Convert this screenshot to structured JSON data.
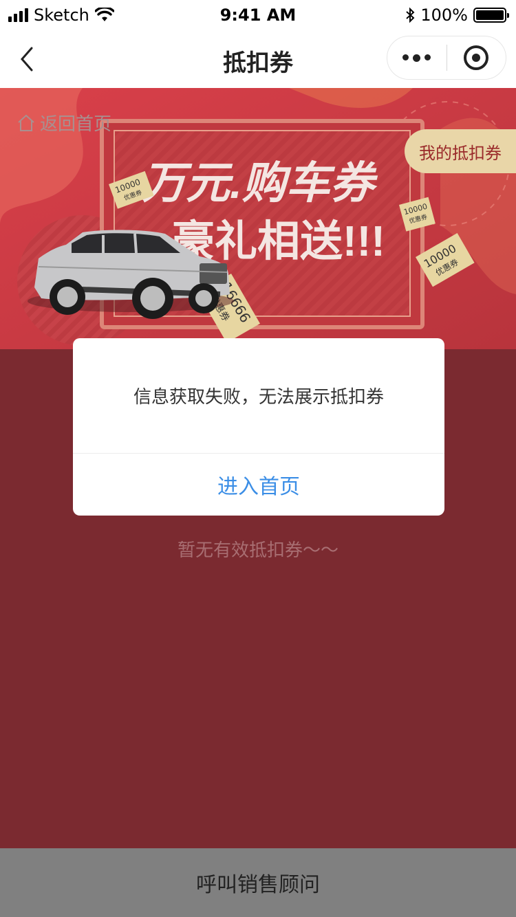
{
  "status_bar": {
    "carrier": "Sketch",
    "time": "9:41 AM",
    "battery": "100%"
  },
  "nav": {
    "title": "抵扣券",
    "icons": [
      "back-chevron-icon",
      "more-dots-icon",
      "close-target-icon"
    ]
  },
  "banner": {
    "home_link": "返回首页",
    "headline_line1": "万元.购车券",
    "headline_line2": "豪礼相送!!!",
    "my_coupons": "我的抵扣券",
    "tickets": [
      {
        "amount": "10000",
        "label": "优惠券"
      },
      {
        "amount": "16666",
        "label": "优惠券"
      },
      {
        "amount": "10000",
        "label": "优惠券"
      },
      {
        "amount": "10000",
        "label": "优惠券"
      }
    ]
  },
  "empty_text": "暂无有效抵扣券～～",
  "dialog": {
    "message": "信息获取失败，无法展示抵扣券",
    "button": "进入首页"
  },
  "bottom_bar": {
    "label": "呼叫销售顾问"
  },
  "colors": {
    "background": "#7b2a30",
    "accent_gold": "#e9d6a8",
    "link_blue": "#3b8ee6",
    "bottom_bar": "#808080"
  }
}
